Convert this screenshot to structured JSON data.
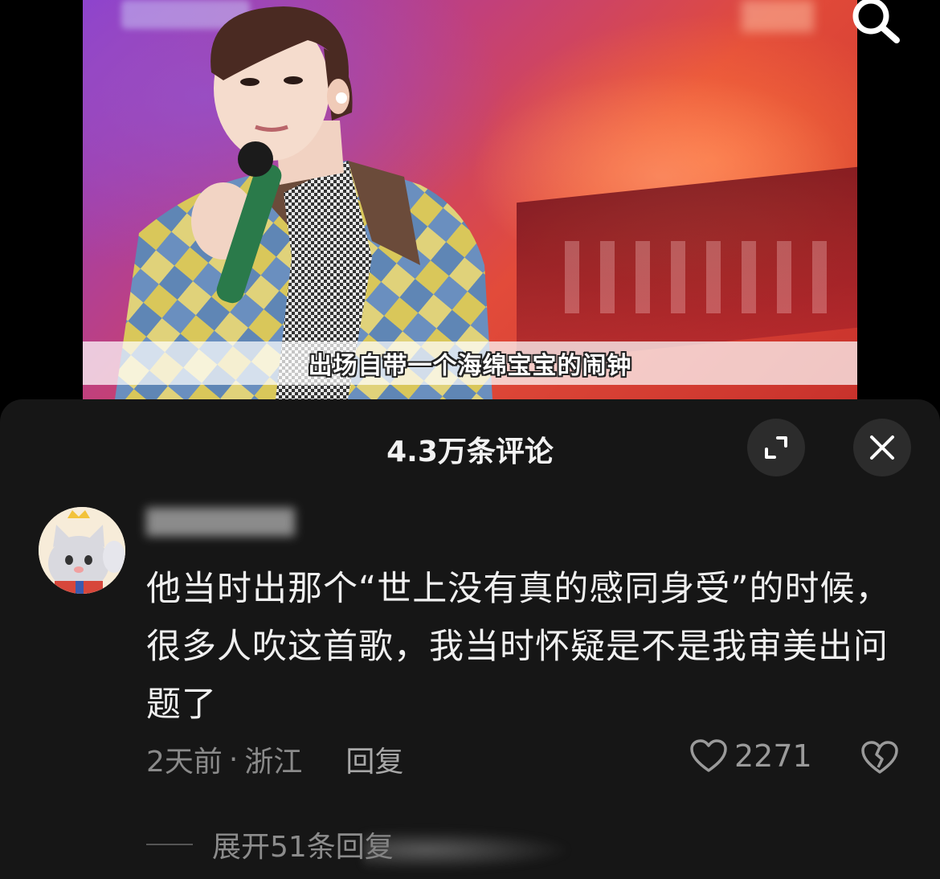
{
  "video": {
    "subtitle": "出场自带一个海绵宝宝的闹钟",
    "search_icon": "search-icon"
  },
  "comments_panel": {
    "title": "4.3万条评论",
    "expand_icon": "expand-icon",
    "close_icon": "close-icon"
  },
  "comment": {
    "text": "他当时出那个“世上没有真的感同身受”的时候，很多人吹这首歌，我当时怀疑是不是我审美出问题了",
    "time": "2天前",
    "separator": "·",
    "location": "浙江",
    "reply_label": "回复",
    "like_count": "2271",
    "like_icon": "heart-icon",
    "dislike_icon": "broken-heart-icon"
  },
  "replies": {
    "expand_label": "展开51条回复"
  },
  "colors": {
    "sheet_bg": "#161616",
    "text_primary": "#f0f0f0",
    "text_secondary": "#8a8a8a",
    "button_bg": "#2c2c2c"
  }
}
